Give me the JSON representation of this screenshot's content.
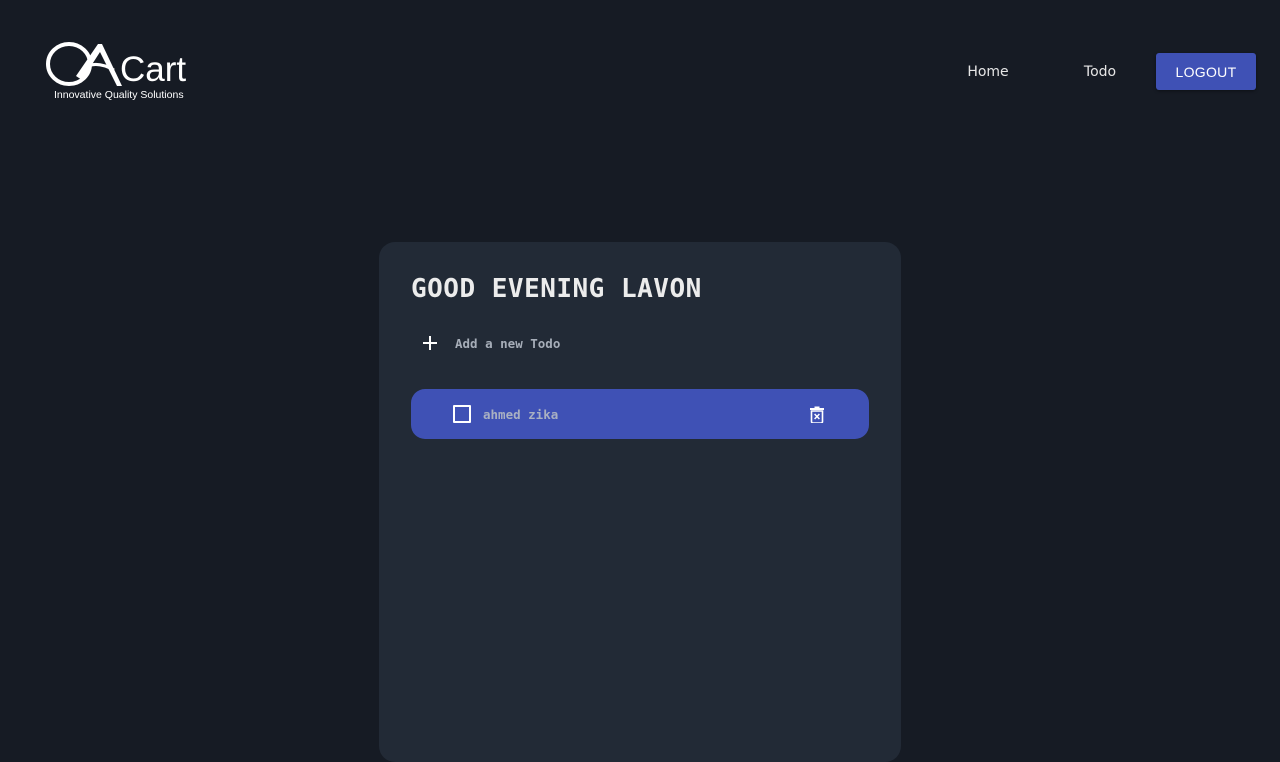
{
  "header": {
    "logo": {
      "brand_suffix": "Cart",
      "tagline": "Innovative Quality Solutions"
    },
    "nav": {
      "items": [
        {
          "label": "Home"
        },
        {
          "label": "Todo"
        }
      ],
      "logout_label": "LOGOUT"
    }
  },
  "main": {
    "greeting": "GOOD EVENING LAVON",
    "add_todo": {
      "placeholder": "Add a new Todo",
      "value": ""
    },
    "todos": [
      {
        "text": "ahmed zika",
        "completed": false
      }
    ]
  },
  "colors": {
    "background": "#161b24",
    "card": "#222a36",
    "accent": "#3f51b5"
  }
}
